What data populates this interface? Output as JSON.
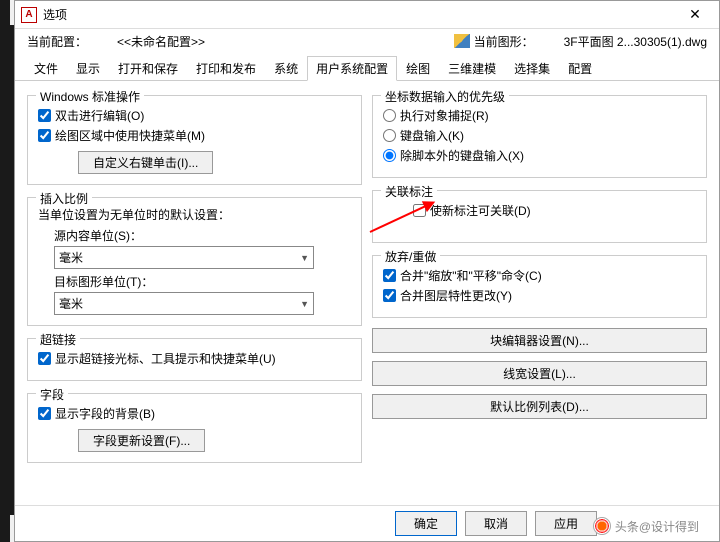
{
  "window": {
    "app_icon_letter": "A",
    "title": "选项"
  },
  "profile": {
    "current_label": "当前配置：",
    "current_value": "<<未命名配置>>",
    "drawing_label": "当前图形：",
    "drawing_value": "3F平面图 2...30305(1).dwg"
  },
  "tabs": [
    "文件",
    "显示",
    "打开和保存",
    "打印和发布",
    "系统",
    "用户系统配置",
    "绘图",
    "三维建模",
    "选择集",
    "配置"
  ],
  "left": {
    "group1_title": "Windows 标准操作",
    "chk_dblclick": "双击进行编辑(O)",
    "chk_shortcut": "绘图区域中使用快捷菜单(M)",
    "btn_custom_rclick": "自定义右键单击(I)...",
    "group2_title": "插入比例",
    "group2_sub": "当单位设置为无单位时的默认设置：",
    "src_units_label": "源内容单位(S)：",
    "src_units_value": "毫米",
    "tgt_units_label": "目标图形单位(T)：",
    "tgt_units_value": "毫米",
    "hyper_title": "超链接",
    "hyper_chk": "显示超链接光标、工具提示和快捷菜单(U)",
    "fields_title": "字段",
    "fields_chk": "显示字段的背景(B)",
    "fields_btn": "字段更新设置(F)..."
  },
  "right": {
    "priority_title": "坐标数据输入的优先级",
    "opt1": "执行对象捕捉(R)",
    "opt2": "键盘输入(K)",
    "opt3": "除脚本外的键盘输入(X)",
    "assoc_title": "关联标注",
    "assoc_chk": "使新标注可关联(D)",
    "undo_title": "放弃/重做",
    "undo_chk1": "合并\"缩放\"和\"平移\"命令(C)",
    "undo_chk2": "合并图层特性更改(Y)",
    "btn_block": "块编辑器设置(N)...",
    "btn_linewt": "线宽设置(L)...",
    "btn_scale": "默认比例列表(D)..."
  },
  "footer": {
    "ok": "确定",
    "cancel": "取消",
    "apply": "应用"
  },
  "watermark": "头条@设计得到"
}
